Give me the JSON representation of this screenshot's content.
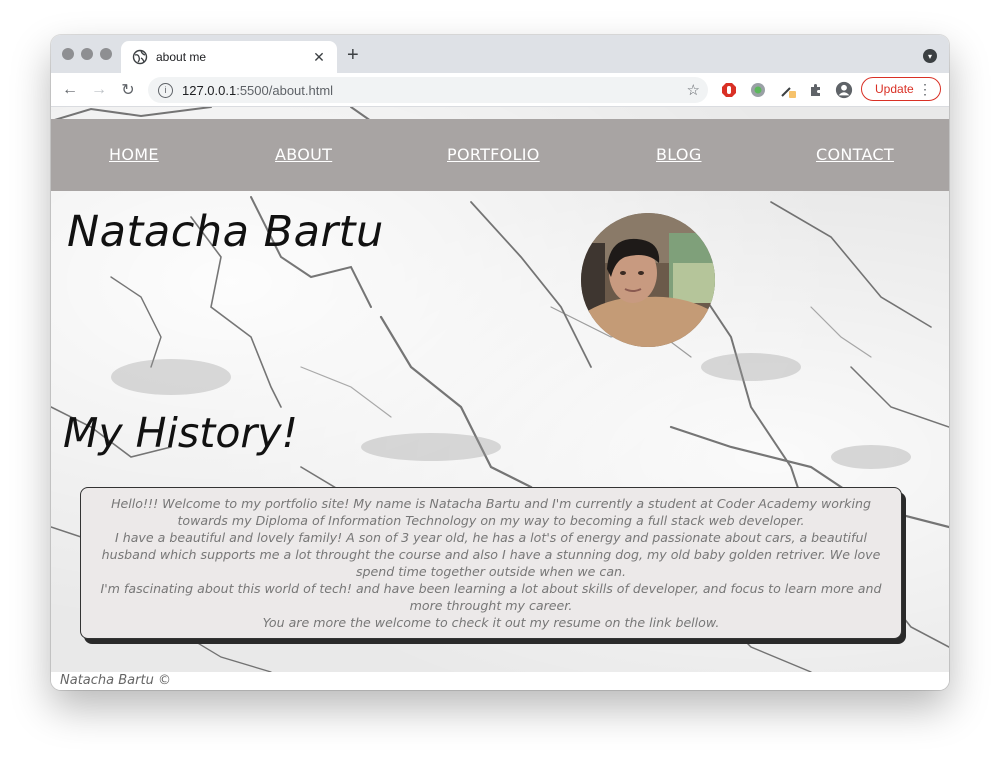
{
  "browser": {
    "tab_title": "about me",
    "url_host": "127.0.0.1",
    "url_path": ":5500/about.html",
    "update_label": "Update",
    "icons": [
      "globe-icon",
      "close-icon",
      "plus-icon",
      "back-icon",
      "forward-icon",
      "reload-icon",
      "info-icon",
      "star-icon",
      "extension-icons",
      "profile-icon",
      "kebab-icon"
    ]
  },
  "nav": {
    "home": "HOME",
    "about": "ABOUT",
    "portfolio": "PORTFOLIO",
    "blog": "BLOG",
    "contact": "CONTACT"
  },
  "page": {
    "name": "Natacha Bartu",
    "history_heading": "My History!",
    "bio": [
      "Hello!!! Welcome to my portfolio site! My name is Natacha Bartu and I'm currently a student at Coder Academy working towards my Diploma of Information Technology on my way to becoming a full stack web developer.",
      "I have a beautiful and lovely family! A son of 3 year old, he has a lot's of energy and passionate about cars, a beautiful husband which supports me a lot throught the course and also I have a stunning dog, my old baby golden retriver. We love spend time together outside when we can.",
      "I'm fascinating about this world of tech! and have been learning a lot about skills of developer, and focus to learn more and more throught my career.",
      "You are more the welcome to check it out my resume on the link bellow."
    ],
    "footer": "Natacha Bartu ©"
  },
  "colors": {
    "navbar_bg": "#a8a4a3",
    "bio_bg": "#ece9e9",
    "update_red": "#d93025"
  }
}
